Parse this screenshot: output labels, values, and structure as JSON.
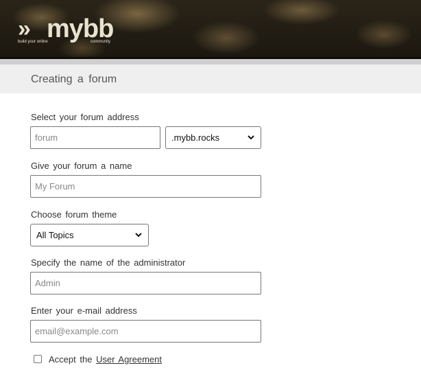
{
  "header": {
    "logo_mark": "»",
    "logo_text": "mybb",
    "tagline_left": "build your online",
    "tagline_right": "community"
  },
  "page": {
    "title": "Creating a forum"
  },
  "form": {
    "address_label": "Select your forum address",
    "address_placeholder": "forum",
    "domain_selected": ".mybb.rocks",
    "name_label": "Give your forum a name",
    "name_placeholder": "My Forum",
    "theme_label": "Choose forum theme",
    "theme_selected": "All Topics",
    "admin_label": "Specify the name of the administrator",
    "admin_placeholder": "Admin",
    "email_label": "Enter your e-mail address",
    "email_placeholder": "email@example.com",
    "accept_text": "Accept the",
    "agreement_link": "User Agreement",
    "accept_checked": false
  }
}
